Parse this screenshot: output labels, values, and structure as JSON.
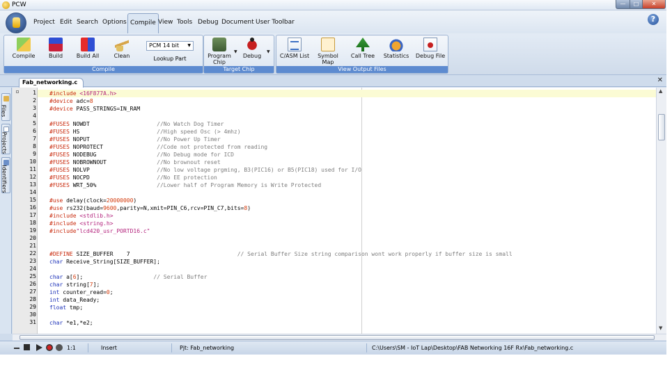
{
  "window": {
    "title": "PCW"
  },
  "menu": {
    "tabs": [
      "Project",
      "Edit",
      "Search",
      "Options",
      "Compile",
      "View",
      "Tools",
      "Debug",
      "Document",
      "User Toolbar"
    ],
    "active_tab": "Compile"
  },
  "ribbon": {
    "compile_group": {
      "label": "Compile",
      "buttons": [
        "Compile",
        "Build",
        "Build All",
        "Clean"
      ],
      "chip_select": "PCM 14 bit",
      "lookup_part": "Lookup Part"
    },
    "target_chip_group": {
      "label": "Target Chip",
      "program_chip_line1": "Program",
      "program_chip_line2": "Chip",
      "debug": "Debug"
    },
    "output_group": {
      "label": "View Output Files",
      "buttons": [
        "C/ASM List",
        "Symbol Map",
        "Call Tree",
        "Statistics",
        "Debug File"
      ]
    }
  },
  "editor": {
    "tab_name": "Fab_networking.c",
    "side_tabs": [
      "Files",
      "Projects",
      "Identifiers"
    ],
    "lines": [
      "#include <16F877A.h>",
      "#device adc=8",
      "#device PASS_STRINGS=IN_RAM",
      "",
      "#FUSES NOWDT                    //No Watch Dog Timer",
      "#FUSES HS                       //High speed Osc (> 4mhz)",
      "#FUSES NOPUT                    //No Power Up Timer",
      "#FUSES NOPROTECT                //Code not protected from reading",
      "#FUSES NODEBUG                  //No Debug mode for ICD",
      "#FUSES NOBROWNOUT               //No brownout reset",
      "#FUSES NOLVP                    //No low voltage prgming, B3(PIC16) or B5(PIC18) used for I/O",
      "#FUSES NOCPD                    //No EE protection",
      "#FUSES WRT_50%                  //Lower half of Program Memory is Write Protected",
      "",
      "#use delay(clock=20000000)",
      "#use rs232(baud=9600,parity=N,xmit=PIN_C6,rcv=PIN_C7,bits=8)",
      "#include <stdlib.h>",
      "#include <string.h>",
      "#include\"lcd420_usr_PORTD16.c\"",
      "",
      "",
      "#DEFINE SIZE_BUFFER    7                                // Serial Buffer Size string comparison wont work properly if buffer size is small",
      "char Receive_String[SIZE_BUFFER];",
      "",
      "char a[6];                     // Serial Buffer",
      "char string[7];",
      "int counter_read=0;",
      "int data_Ready;",
      "float tmp;",
      "",
      "char *e1,*e2;"
    ]
  },
  "status": {
    "position": "1:1",
    "mode": "Insert",
    "project": "Pjt: Fab_networking",
    "path": "C:\\Users\\SM - IoT Lap\\Desktop\\FAB Networking 16F Rx\\Fab_networking.c"
  },
  "colors": {
    "ribbon_group_label": "#5d8bd0",
    "preprocessor": "#c8280a",
    "comment": "#7d7d7d",
    "keyword": "#1b30b8",
    "current_line": "#fbfbd4"
  },
  "icons": {
    "app": "pcw-app-icon",
    "help": "help-icon",
    "compile": "compile-icon",
    "build": "build-icon",
    "build_all": "build-all-icon",
    "clean": "broom-icon",
    "program_chip": "chip-programmer-icon",
    "debug": "bug-icon",
    "asm_list": "document-icon",
    "symbol_map": "symbol-map-icon",
    "call_tree": "tree-icon",
    "statistics": "statistics-icon",
    "debug_file": "debug-file-icon"
  }
}
